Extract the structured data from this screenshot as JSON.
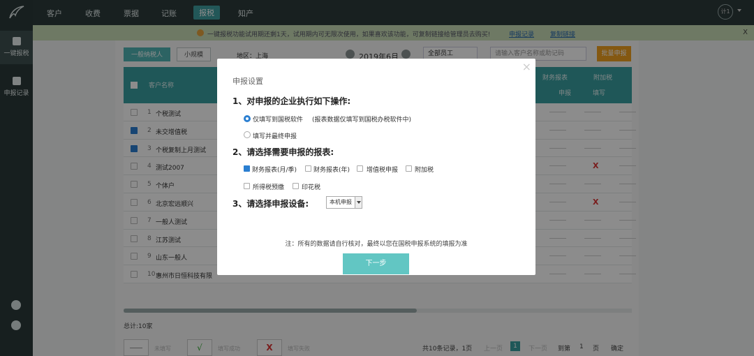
{
  "nav": {
    "items": [
      "客户",
      "收费",
      "票据",
      "记账",
      "报税",
      "知产"
    ],
    "active_index": 4,
    "user_initial": "计1"
  },
  "sidebar": {
    "items": [
      {
        "label": "一键报税",
        "active": true
      },
      {
        "label": "申报记录",
        "active": false
      }
    ],
    "bottom_icons": [
      "phone-icon",
      "headset-icon"
    ]
  },
  "notice": {
    "message": "一键报税功能试用期还剩1天，试用期内可无限次使用，如果喜欢该功能，可复制链接给管理员去购买!",
    "link1": "申报记录",
    "link2": "复制链接",
    "close": "X"
  },
  "filters": {
    "tab1": "一般纳税人",
    "tab2": "小规模",
    "region": "地区：上海",
    "period": "2019年6月",
    "staff": "全部员工",
    "search_placeholder": "请输入客户名称或助记码",
    "batch_button": "批量申报"
  },
  "table": {
    "col_name": "客户名称",
    "group1": "财务报表",
    "group2": "附加税",
    "sub1": "申报",
    "sub2": "填写",
    "rows": [
      {
        "num": "1",
        "name": "个税测试",
        "checked": false,
        "x": false
      },
      {
        "num": "2",
        "name": "未交增值税",
        "checked": true,
        "x": false
      },
      {
        "num": "3",
        "name": "个税复制上月测试",
        "checked": true,
        "x": false
      },
      {
        "num": "4",
        "name": "测试2007",
        "checked": false,
        "x": true
      },
      {
        "num": "5",
        "name": "个体户",
        "checked": false,
        "x": false
      },
      {
        "num": "6",
        "name": "北京宏远顺兴",
        "checked": false,
        "x": true
      },
      {
        "num": "7",
        "name": "一般人测试",
        "checked": false,
        "x": false
      },
      {
        "num": "8",
        "name": "江苏测试",
        "checked": false,
        "x": false
      },
      {
        "num": "9",
        "name": "山东一般人",
        "checked": false,
        "x": false
      },
      {
        "num": "10",
        "name": "惠州市日恒科技有限",
        "checked": false,
        "x": false
      }
    ]
  },
  "footer": {
    "total": "总计:10家",
    "legend1": "未填写",
    "legend2": "填写成功",
    "legend3": "填写失败",
    "check_mark": "√",
    "x_mark": "X",
    "records": "共10条记录，1页",
    "prev": "上一页",
    "page": "1",
    "next": "下一页",
    "goto": "到第",
    "goto_page": "1",
    "page_unit": "页",
    "confirm": "确定"
  },
  "modal": {
    "title": "申报设置",
    "close": "×",
    "h1": "1、对申报的企业执行如下操作:",
    "opt1": "仅填写到国税软件",
    "opt1_note": "(报表数据仅填写到国税办税软件中)",
    "opt2": "填写并最终申报",
    "h2": "2、请选择需要申报的报表:",
    "reports": [
      {
        "label": "财务报表(月/季)",
        "checked": true
      },
      {
        "label": "财务报表(年)",
        "checked": false
      },
      {
        "label": "增值税申报",
        "checked": false
      },
      {
        "label": "附加税",
        "checked": false
      },
      {
        "label": "所得税预缴",
        "checked": false
      },
      {
        "label": "印花税",
        "checked": false
      }
    ],
    "h3": "3、请选择申报设备:",
    "device": "本机申报",
    "note": "注：所有的数据请自行核对，最终以您在国税申报系统的填报为准",
    "next": "下一步"
  }
}
